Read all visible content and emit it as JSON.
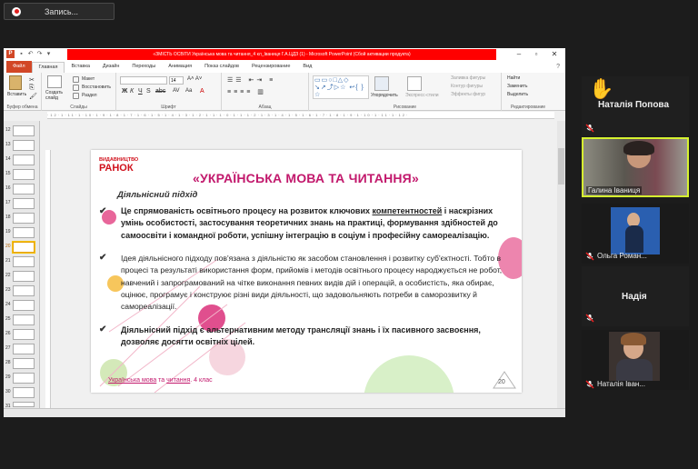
{
  "recording": {
    "label": "Запись..."
  },
  "window": {
    "title": "«ЗМІСТЬ ОСВІТИ Українська мова та читання_4 кл_Іваниця Г.А.ЦДЗ (1) - Microsoft PowerPoint (Сбой активации продукта)"
  },
  "ribbon_tabs": [
    "Файл",
    "Главная",
    "Вставка",
    "Дизайн",
    "Переходы",
    "Анимация",
    "Показ слайдов",
    "Рецензирование",
    "Вид"
  ],
  "ribbon": {
    "paste": "Вставить",
    "create_slide": "Создать слайд",
    "layout": "Макет",
    "restore": "Восстановить",
    "section": "Раздел",
    "group_clipboard": "Буфер обмена",
    "group_slides": "Слайды",
    "group_font": "Шрифт",
    "group_paragraph": "Абзац",
    "group_drawing": "Рисование",
    "group_editing": "Редактирование",
    "arrange": "Упорядочить",
    "express_styles": "Экспресс-стили",
    "shape_fill": "Заливка фигуры",
    "shape_outline": "Контур фигуры",
    "shape_effects": "Эффекты фигур",
    "find": "Найти",
    "replace": "Заменить",
    "select": "Выделить",
    "font_size": "14"
  },
  "thumbnails": [
    "12",
    "13",
    "14",
    "15",
    "16",
    "17",
    "18",
    "19",
    "20",
    "21",
    "22",
    "23",
    "24",
    "25",
    "26",
    "27",
    "28",
    "29",
    "30",
    "31"
  ],
  "selected_thumbnail": "20",
  "slide": {
    "logo_top": "ВИДАВНИЦТВО",
    "logo_main": "РАНОК",
    "title": "«УКРАЇНСЬКА МОВА ТА ЧИТАННЯ»",
    "subtitle": "Діяльнісний підхід",
    "p1_a": "Це спрямованість освітнього процесу на розвиток ключових ",
    "p1_link": "компетентностей",
    "p1_b": " і наскрізних умінь особистості, застосування теоретичних знань на практиці, формування здібностей до самоосвіти і командної роботи, успішну інтеграцію в соціум і професійну самореалізацію.",
    "p2": "Ідея діяльнісного підходу пов'язана з діяльністю як засобом становлення і розвитку суб'єктності. Тобто в процесі та результаті використання форм, прийомів і методів освітнього процесу народжується не робот, навчений і запрограмований на чітке виконання певних видів дій і операцій, а особистість, яка обирає, оцінює, програмує і конструює різні види діяльності, що задовольняють потреби в саморозвитку й самореалізації.",
    "p3": "Діяльнісний підхід є альтернативним методу трансляції знань і їх пасивного засвоєння, дозволяє досягти освітніх цілей.",
    "footer_a": "Українська мова",
    "footer_mid": " та ",
    "footer_b": "читання",
    "footer_c": ". 4 клас",
    "page": "20"
  },
  "participants": [
    {
      "name": "Наталія Попова",
      "hand_raised": true,
      "muted": true
    },
    {
      "name": "Галина Іваниця",
      "active_speaker": true
    },
    {
      "name": "Ольга Роман...",
      "muted": true
    },
    {
      "name": "Надія",
      "muted": true
    },
    {
      "name": "Наталія Іван...",
      "muted": true
    }
  ],
  "colors": {
    "accent": "#c2186c",
    "brand_red": "#d0101b",
    "speaker_border": "#d6f230",
    "ppt_file_tab": "#d24726"
  }
}
